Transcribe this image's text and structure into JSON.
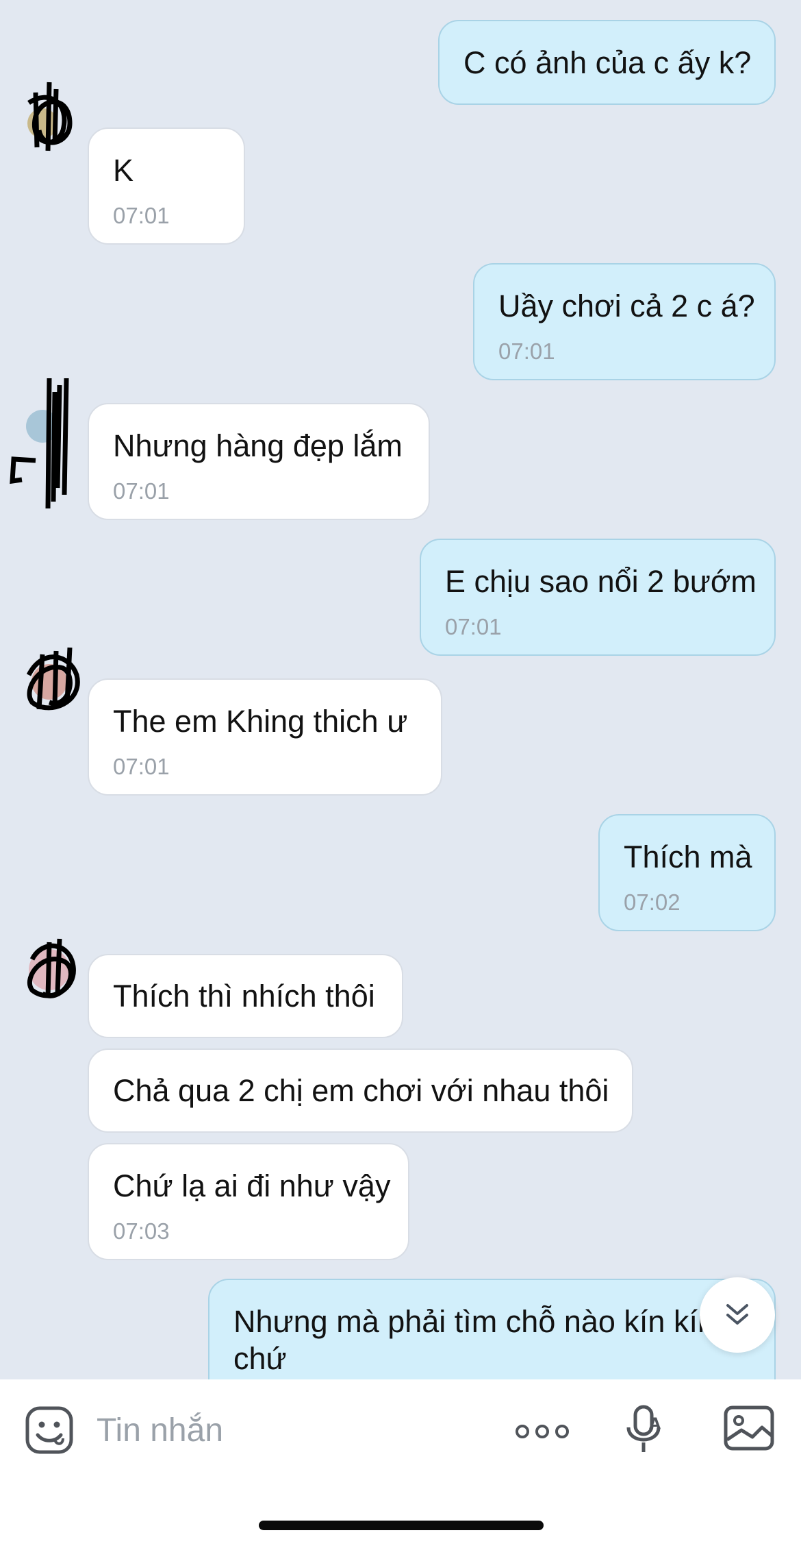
{
  "messages": [
    {
      "direction": "out",
      "text": "C có ảnh của c ấy k?",
      "time": ""
    },
    {
      "direction": "in",
      "text": "K",
      "time": "07:01"
    },
    {
      "direction": "out",
      "text": "Uầy chơi cả 2 c á?",
      "time": "07:01"
    },
    {
      "direction": "in",
      "text": "Nhưng hàng đẹp lắm",
      "time": "07:01"
    },
    {
      "direction": "out",
      "text": "E chịu sao nổi 2 bướm",
      "time": "07:01"
    },
    {
      "direction": "in",
      "text": "The em  Khing thich ư",
      "time": "07:01"
    },
    {
      "direction": "out",
      "text": "Thích mà",
      "time": "07:02"
    },
    {
      "direction": "in",
      "text": "Thích thì nhích thôi",
      "time": ""
    },
    {
      "direction": "in",
      "text": "Chả qua 2 chị em chơi với nhau thôi",
      "time": ""
    },
    {
      "direction": "in",
      "text": "Chứ lạ ai đi như vậy",
      "time": "07:03"
    },
    {
      "direction": "out",
      "text": "Nhưng mà phải tìm chỗ nào kín kín",
      "text2": "chứ",
      "time": ""
    }
  ],
  "composer": {
    "placeholder": "Tin nhắn",
    "icons": [
      "emoji-icon",
      "more-icon",
      "voice-to-text-icon",
      "gallery-icon"
    ]
  },
  "scroll_button": {
    "icon": "double-chevron-down-icon"
  },
  "colors": {
    "background": "#e2e8f1",
    "incoming_bubble": "#ffffff",
    "outgoing_bubble": "#d2effb",
    "outgoing_border": "#a9d3e6",
    "time": "#9aa1a9"
  }
}
